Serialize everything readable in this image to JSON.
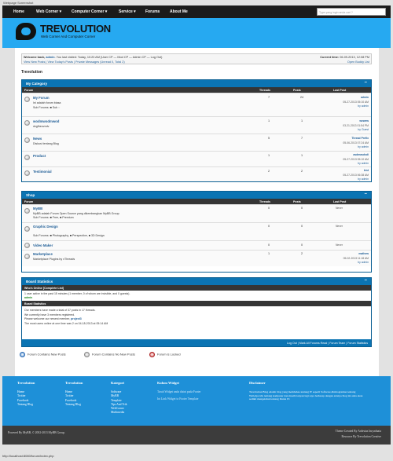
{
  "caption": "Webpage Screenshot",
  "nav": {
    "items": [
      {
        "label": "Home"
      },
      {
        "label": "Web Corner ▾"
      },
      {
        "label": "Computer Corner ▾"
      },
      {
        "label": "Service ▾"
      },
      {
        "label": "Forums"
      },
      {
        "label": "About Me"
      }
    ],
    "search_placeholder": "Type yang ingin anda cari ?"
  },
  "header": {
    "title": "TREVOLUTION",
    "tagline": "Web Corner And Computer Corner"
  },
  "welcome": {
    "line1_prefix": "Welcome back, ",
    "user": "admin",
    "line1_rest": ". You last visited: Today, 10:20 AM (User CP — Mod CP — Admin CP — Log Out)",
    "line2": "View New Posts | View Today's Posts | Private Messages (Unread 0, Total 2)",
    "time_label": "Current time:",
    "time_value": "06-09-2013, 12:08 PM",
    "buddy": "Open Buddy List"
  },
  "breadcrumb": "Trevolution",
  "cols": {
    "forum": "Forum",
    "threads": "Threads",
    "posts": "Posts",
    "last_post": "Last Post"
  },
  "category1": {
    "title": "My Category",
    "collapse": "–",
    "forums": [
      {
        "name": "My Forum",
        "desc": "Ini adalah forum biasa",
        "sub": "Sub Forums: ■ Sub ◌",
        "threads": "7",
        "posts": "24",
        "lp1": "admin",
        "lp2": "05-27-2013 05:10 AM",
        "lp3": "by admin"
      },
      {
        "name": "wodmwodmwod",
        "desc": "dvgfheovndv",
        "sub": "",
        "threads": "1",
        "posts": "1",
        "lp1": "wewew",
        "lp2": "03-21-2013 01:54 PM",
        "lp3": "by Guest"
      },
      {
        "name": "News",
        "desc": "Diskusi tentang Blog",
        "sub": "",
        "threads": "5",
        "posts": "7",
        "lp1": "Thread Prefix",
        "lp2": "05-06-2013 07:24 AM",
        "lp3": "by admin"
      },
      {
        "name": "Product",
        "desc": "",
        "sub": "",
        "threads": "1",
        "posts": "1",
        "lp1": "asdmasdsdi",
        "lp2": "05-27-2013 05:10 AM",
        "lp3": "by admin"
      },
      {
        "name": "Testimonial",
        "desc": "",
        "sub": "",
        "threads": "2",
        "posts": "2",
        "lp1": "test",
        "lp2": "05-27-2013 06:38 AM",
        "lp3": "by admin"
      }
    ]
  },
  "category2": {
    "title": "Shop",
    "collapse": "–",
    "forums": [
      {
        "name": "MyBB",
        "desc": "MyBB adalah Forum Open Source yang dikembangkan MyBB Group",
        "sub": "Sub Forums: ■ Free, ■ Premium",
        "threads": "0",
        "posts": "0",
        "lp1": "",
        "lp2": "Never",
        "lp3": ""
      },
      {
        "name": "Graphic Design",
        "desc": "",
        "sub": "Sub Forums: ■ Photography, ■ Perspective, ■ 3D Design",
        "threads": "0",
        "posts": "0",
        "lp1": "",
        "lp2": "Never",
        "lp3": ""
      },
      {
        "name": "Video Maker",
        "desc": "",
        "sub": "",
        "threads": "0",
        "posts": "0",
        "lp1": "",
        "lp2": "Never",
        "lp3": ""
      },
      {
        "name": "Marketplace",
        "desc": "Marketplace Plugins by vThreads",
        "sub": "",
        "threads": "1",
        "posts": "2",
        "lp1": "mathew",
        "lp2": "05-02-2013 11:18 AM",
        "lp3": "by admin"
      }
    ]
  },
  "stats": {
    "title": "Board Statistics",
    "collapse": "–",
    "who_head": "Who's Online [Complete List]",
    "who_line": "1 user active in the past 15 minutes (1 member, 0 of whom are invisible, and 0 guests).",
    "who_user": "admin",
    "board_head": "Board Statistics",
    "s1": "Our members have made a total of 37 posts in 17 threads.",
    "s2": "We currently have 3 members registered.",
    "s3_prefix": "Please welcome our newest member, ",
    "s3_user": "project3",
    "s4": "The most users online at one time was 2 on 04-18-2013 at 05:14 AM",
    "foot": "Log Out | Mark All Forums Read | Forum Team | Forum Statistics"
  },
  "legend": {
    "new": "Forum Contains New Posts",
    "nonew": "Forum Contains No New Posts",
    "locked": "Forum is Locked"
  },
  "footer": {
    "col1": {
      "head": "Trevolution",
      "items": [
        "Home",
        "Twitter",
        "Facebook",
        "Tentang Blog"
      ]
    },
    "col2": {
      "head": "Trevolution",
      "items": [
        "Home",
        "Twitter",
        "Facebook",
        "Tentang Blog"
      ]
    },
    "col3": {
      "head": "Kategori",
      "items": [
        "Software",
        "MyBB",
        "Template",
        "Tips And Trik",
        "WebCorner",
        "Multimedia"
      ]
    },
    "col4": {
      "head": "Kolom Widget",
      "items": [
        "Taruh Widget anda disini pada Footer",
        "Ini Link Widget to Footer Template"
      ]
    },
    "col5": {
      "head": "Disclaimer",
      "text": "Trevolution Blog adalah blog yang membahas tentang IT seperti Software,Pemrograman tentang Web,tips trik tentang komputer dan masih banyak lagi saya berharap dengan adanya blog ini anda akan sedikit mengetahui tentang Dunia IT."
    }
  },
  "bottom": {
    "left": "Powered By MyBB, © 2002-2013 MyBB Group.",
    "right1": "Theme Created By Ardesiaz Inryadnata",
    "right2": "Resource By Trevolution Creative"
  },
  "status_url": "http://localhost:8080/forum/index.php"
}
